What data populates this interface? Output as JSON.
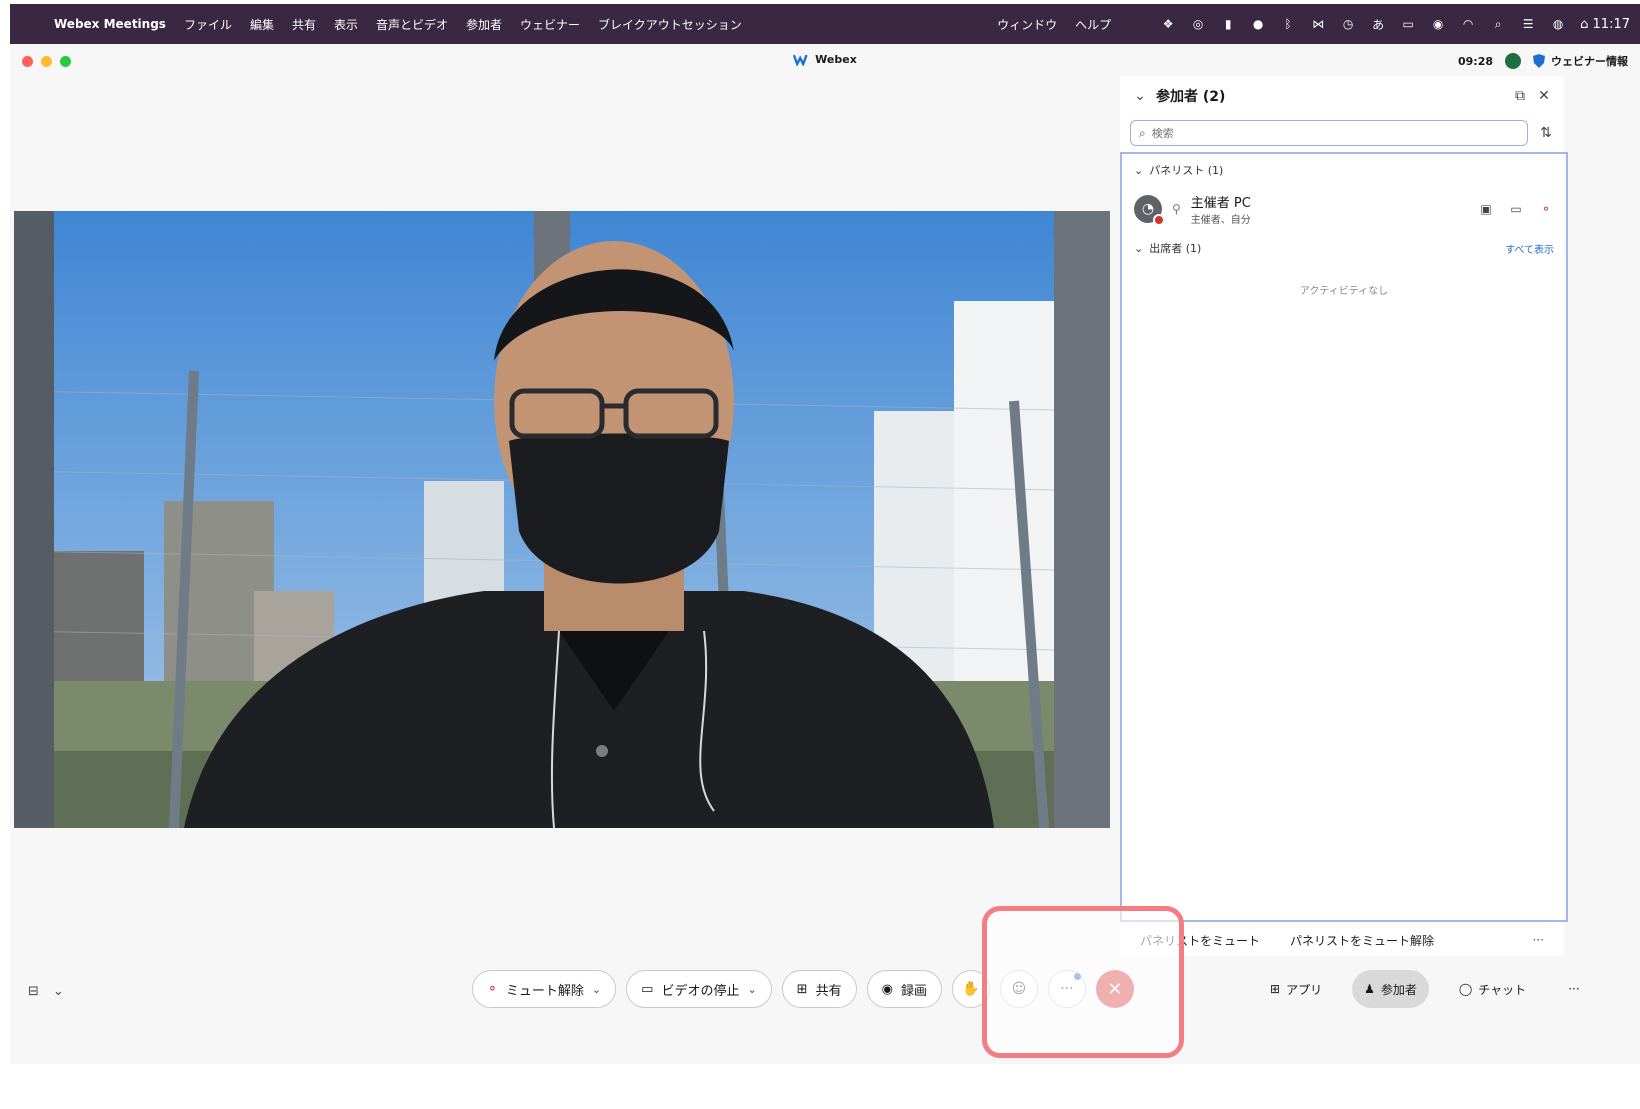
{
  "menubar": {
    "apple_icon": "apple-icon",
    "app_name": "Webex Meetings",
    "items": [
      "ファイル",
      "編集",
      "共有",
      "表示",
      "音声とビデオ",
      "参加者",
      "ウェビナー",
      "ブレイクアウトセッション"
    ],
    "right_items": [
      "ウィンドウ",
      "ヘルプ"
    ],
    "clock": "11:17"
  },
  "window": {
    "title": "Webex",
    "meeting_time": "09:28",
    "webinar_info": "ウェビナー情報"
  },
  "panel": {
    "title": "参加者 (2)",
    "search_placeholder": "検索",
    "panelist_section": "パネリスト (1)",
    "participant": {
      "name": "主催者 PC",
      "role": "主催者、自分"
    },
    "attendee_section": "出席者 (1)",
    "show_all": "すべて表示",
    "no_activity": "アクティビティなし",
    "footer": {
      "mute_panelists": "パネリストをミュート",
      "unmute_panelists": "パネリストをミュート解除",
      "more": "···"
    }
  },
  "controls": {
    "unmute": "ミュート解除",
    "stop_video": "ビデオの停止",
    "share": "共有",
    "record": "録画",
    "more": "···",
    "end": "✕",
    "apps": "アプリ",
    "participants": "参加者",
    "chat": "チャット",
    "right_more": "···"
  },
  "colors": {
    "menubar": "#3a2742",
    "end_button": "#d93a3a",
    "highlight": "#f37d83",
    "accent": "#1d6fd1"
  }
}
